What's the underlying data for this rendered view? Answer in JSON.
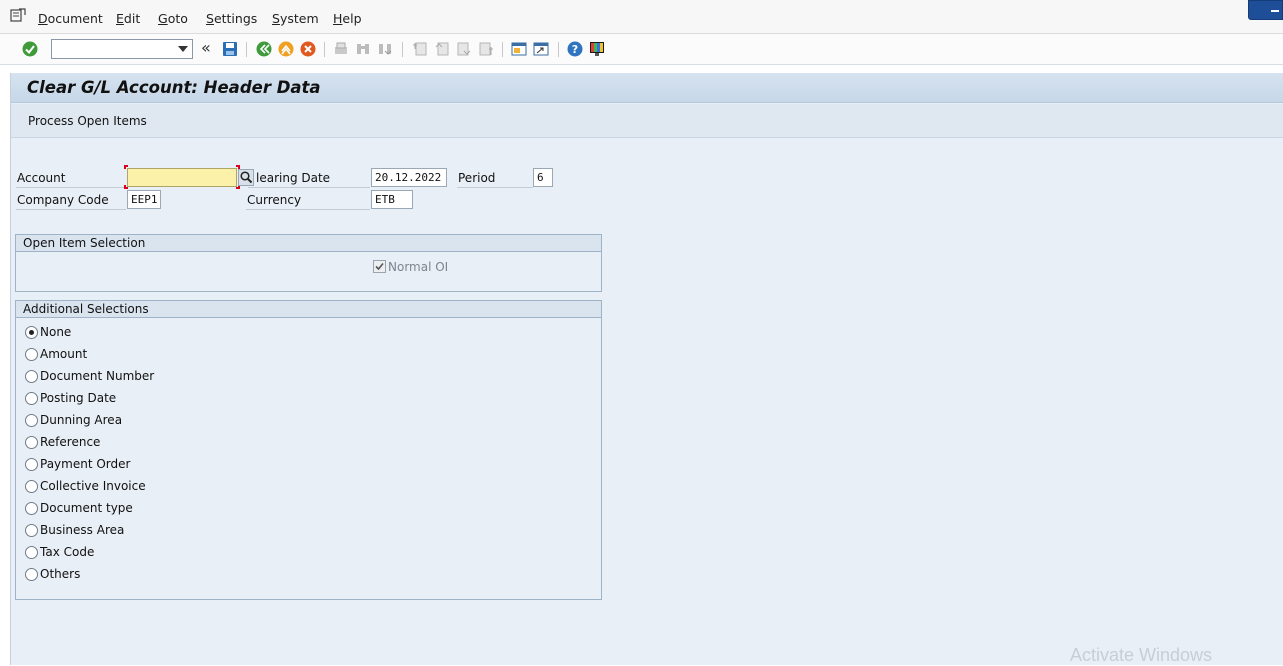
{
  "menu": {
    "items": [
      {
        "label": "Document",
        "ul": "D",
        "rest": "ocument"
      },
      {
        "label": "Edit",
        "ul": "E",
        "rest": "dit"
      },
      {
        "label": "Goto",
        "ul": "G",
        "rest": "oto"
      },
      {
        "label": "Settings",
        "ul": "S",
        "rest": "ettings"
      },
      {
        "label": "System",
        "ul": "S",
        "rest": "ystem"
      },
      {
        "label": "Help",
        "ul": "H",
        "rest": "elp"
      }
    ]
  },
  "toolbar": {
    "command_field_value": "",
    "icons": [
      "enter-icon",
      "back-icon",
      "save-icon",
      "back-green-icon",
      "exit-icon",
      "cancel-icon",
      "print-icon",
      "find-icon",
      "find-next-icon",
      "first-page-icon",
      "previous-page-icon",
      "next-page-icon",
      "last-page-icon",
      "create-session-icon",
      "shortcut-icon",
      "help-icon",
      "customize-layout-icon"
    ]
  },
  "screen": {
    "title": "Clear G/L Account: Header Data",
    "process_button": "Process Open Items"
  },
  "header": {
    "account_label": "Account",
    "account_value": "",
    "clearing_date_label": "learing Date",
    "clearing_date_value": "20.12.2022",
    "period_label": "Period",
    "period_value": "6",
    "company_code_label": "Company Code",
    "company_code_value": "EEP1",
    "currency_label": "Currency",
    "currency_value": "ETB"
  },
  "open_item_selection": {
    "title": "Open Item Selection",
    "normal_oi_label": "Normal OI",
    "normal_oi_checked": true
  },
  "additional_selections": {
    "title": "Additional Selections",
    "options": [
      {
        "label": "None",
        "selected": true
      },
      {
        "label": "Amount",
        "selected": false
      },
      {
        "label": "Document Number",
        "selected": false
      },
      {
        "label": "Posting Date",
        "selected": false
      },
      {
        "label": "Dunning Area",
        "selected": false
      },
      {
        "label": "Reference",
        "selected": false
      },
      {
        "label": "Payment Order",
        "selected": false
      },
      {
        "label": "Collective Invoice",
        "selected": false
      },
      {
        "label": "Document type",
        "selected": false
      },
      {
        "label": "Business Area",
        "selected": false
      },
      {
        "label": "Tax Code",
        "selected": false
      },
      {
        "label": "Others",
        "selected": false
      }
    ]
  },
  "watermark": "Activate Windows",
  "colors": {
    "accent": "#1f4e99",
    "required_field": "#fbf1a8",
    "content_bg": "#e9eff6"
  }
}
